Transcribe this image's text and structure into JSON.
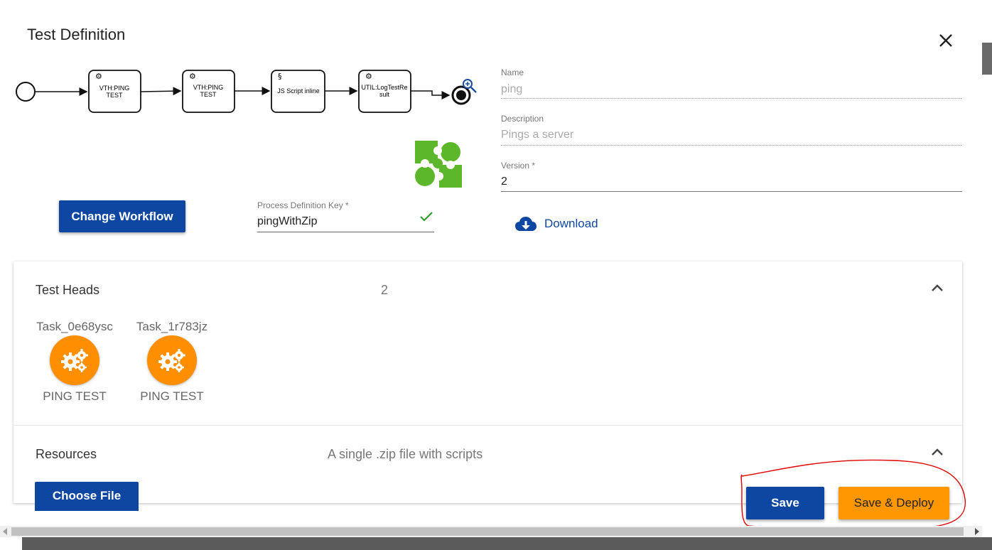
{
  "dialog": {
    "title": "Test Definition",
    "close_icon": "close-icon"
  },
  "workflow": {
    "tasks": [
      "VTH:PING TEST",
      "VTH:PING TEST",
      "JS Script inline",
      "UTIL:LogTestResult"
    ],
    "task_lines": [
      [
        "VTH:PING",
        "TEST"
      ],
      [
        "VTH:PING",
        "TEST"
      ],
      [
        "JS Script inline"
      ],
      [
        "UTIL:LogTestRe",
        "sult"
      ]
    ],
    "change_button": "Change Workflow"
  },
  "process_key": {
    "label": "Process Definition Key *",
    "value": "pingWithZip",
    "valid_icon": "check-icon"
  },
  "form": {
    "name_label": "Name",
    "name_value": "ping",
    "description_label": "Description",
    "description_value": "Pings a server",
    "version_label": "Version *",
    "version_value": "2",
    "download_label": "Download",
    "download_icon": "cloud-download-icon"
  },
  "test_heads": {
    "title": "Test Heads",
    "count": "2",
    "items": [
      {
        "task": "Task_0e68ysc",
        "label": "PING TEST"
      },
      {
        "task": "Task_1r783jz",
        "label": "PING TEST"
      }
    ]
  },
  "resources": {
    "title": "Resources",
    "hint": "A single .zip file with scripts",
    "choose_file": "Choose File"
  },
  "actions": {
    "save": "Save",
    "save_deploy": "Save & Deploy"
  },
  "colors": {
    "primary": "#0d47a1",
    "accent": "#ff9800",
    "success": "#2e9e2e",
    "logo_green": "#5cb82a",
    "annotation": "#e00000"
  }
}
